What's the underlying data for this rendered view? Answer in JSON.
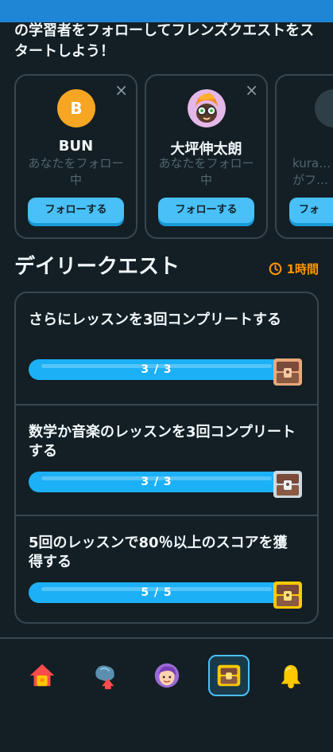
{
  "intro_text": "の学習者をフォローしてフレンズクエストをスタートしよう！",
  "suggestions": [
    {
      "initial": "B",
      "name": "BUN",
      "status": "あなたをフォロー中",
      "button": "フォローする",
      "close": "×"
    },
    {
      "name": "大坪伸太朗",
      "status": "あなたをフォロー中",
      "button": "フォローする",
      "close": "×"
    },
    {
      "name": "",
      "status_partial": "kura…\nがフ…",
      "button_partial": "フォ",
      "close": ""
    }
  ],
  "daily_quests": {
    "title": "デイリークエスト",
    "timer": "1時間",
    "items": [
      {
        "text": "さらにレッスンを3回コンプリートする",
        "progress": "3 / 3",
        "progress_fraction": 1.0,
        "chest": "bronze-chest"
      },
      {
        "text": "数学か音楽のレッスンを3回コンプリートする",
        "progress": "3 / 3",
        "progress_fraction": 1.0,
        "chest": "silver-chest"
      },
      {
        "text": "5回のレッスンで80％以上のスコアを獲得する",
        "progress": "5 / 5",
        "progress_fraction": 1.0,
        "chest": "gold-chest"
      }
    ]
  },
  "nav": [
    "home-icon",
    "learn-icon",
    "profile-icon",
    "quests-icon",
    "notifications-icon"
  ],
  "colors": {
    "accent": "#1cb0f6",
    "button": "#49c0f8",
    "timer": "#ff9600",
    "background": "#131f24",
    "border": "#37464f"
  }
}
